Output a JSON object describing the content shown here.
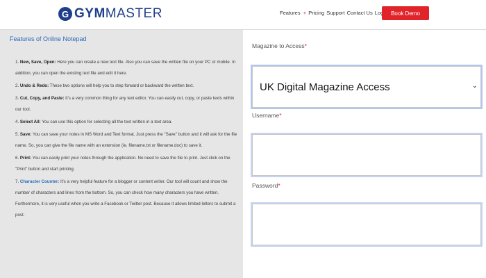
{
  "header": {
    "logo_mark": "G",
    "logo_bold": "GYM",
    "logo_thin": "MASTER",
    "nav_features": "Features",
    "nav_plus": "+",
    "nav_pricing": "Pricing",
    "nav_support": "Support",
    "nav_contact": "Contact Us",
    "nav_login": "Login",
    "book_demo": "Book Demo"
  },
  "left": {
    "title": "Features of Online Notepad",
    "items": [
      {
        "num": "1.",
        "head": "New, Save, Open:",
        "text": "Here you can create a new text file. Also you can save the written file on your PC or mobile. In addition, you can open the existing text file and edit it here."
      },
      {
        "num": "2.",
        "head": "Undo & Redo:",
        "text": "These two options will help you to step forward or backward the written text."
      },
      {
        "num": "3.",
        "head": "Cut, Copy, and Paste:",
        "text": "It's a very common thing for any text editor. You can easily cut, copy, or paste texts within our tool."
      },
      {
        "num": "4.",
        "head": "Select All:",
        "text": "You can use this option for selecting all the text written in a text area."
      },
      {
        "num": "5.",
        "head": "Save:",
        "text": "You can save your notes in MS Word and Text format. Just press the \"Save\" button and it will ask for the file name. So, you can give the file name with an extension (ie. filename.txt or filename.doc) to save it."
      },
      {
        "num": "6.",
        "head": "Print:",
        "text": "You can easily print your notes through the application. No need to save the file to print. Just click on the \"Print\" button and start printing."
      },
      {
        "num": "7.",
        "head": "Character Counter:",
        "text": "It's a very helpful feature for a blogger or content writer. Our tool will count and show the number of characters and lines from the bottom. So, you can check how many characters you have written. Furthermore, it is very useful when you write a Facebook or Twitter post. Because it allows limited letters to submit a post."
      }
    ]
  },
  "form": {
    "magazine_label": "Magazine to Access",
    "magazine_value": "UK Digital Magazine Access",
    "username_label": "Username",
    "password_label": "Password",
    "required_mark": "*",
    "username_value": "",
    "password_value": ""
  },
  "colors": {
    "brand_blue": "#1f3f8a",
    "accent_red": "#e0242a",
    "link_blue": "#2a6bb8"
  }
}
